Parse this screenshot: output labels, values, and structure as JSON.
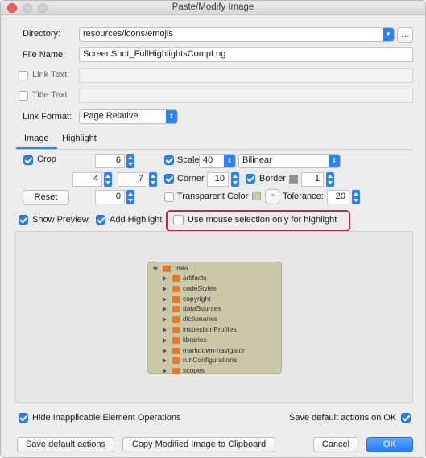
{
  "window": {
    "title": "Paste/Modify Image"
  },
  "directory": {
    "label": "Directory:",
    "value": "resources/icons/emojis",
    "browse_label": "..."
  },
  "file_name": {
    "label": "File Name:",
    "value": "ScreenShot_FullHighlightsCompLog"
  },
  "link_text": {
    "label": "Link Text:",
    "checked": false,
    "value": ""
  },
  "title_text": {
    "label": "Title Text:",
    "checked": false,
    "value": ""
  },
  "link_format": {
    "label": "Link Format:",
    "value": "Page Relative"
  },
  "tabs": [
    {
      "label": "Image",
      "active": true
    },
    {
      "label": "Highlight",
      "active": false
    }
  ],
  "crop": {
    "label": "Crop",
    "checked": true,
    "top": "6",
    "left": "4",
    "right": "7",
    "bottom": "0"
  },
  "scale": {
    "label": "Scale",
    "checked": true,
    "value": "40",
    "method": "Bilinear"
  },
  "corner": {
    "label": "Corner",
    "checked": true,
    "value": "10"
  },
  "border": {
    "label": "Border",
    "checked": true,
    "value": "1",
    "color": "#8e8e8e"
  },
  "reset_label": "Reset",
  "transparent": {
    "label": "Transparent Color",
    "checked": false,
    "color": "#c9c8a7",
    "tolerance_label": "Tolerance:",
    "tolerance": "20"
  },
  "options": {
    "show_preview": "Show Preview",
    "add_highlight": "Add Highlight",
    "mouse_selection": "Use mouse selection only for highlight"
  },
  "preview": {
    "root": ".idea",
    "items": [
      "artifacts",
      "codeStyles",
      "copyright",
      "dataSources",
      "dictionaries",
      "inspectionProfiles",
      "libraries",
      "markdown-navigator",
      "runConfigurations",
      "scopes"
    ]
  },
  "footer": {
    "hide_inapplicable": "Hide Inapplicable Element Operations",
    "save_default_check": "Save default actions on OK",
    "save_default_button": "Save default actions",
    "copy_button": "Copy Modified Image to Clipboard",
    "cancel": "Cancel",
    "ok": "OK"
  },
  "colors": {
    "accent": "#2a82f3",
    "highlight_outline": "#c7244a"
  }
}
